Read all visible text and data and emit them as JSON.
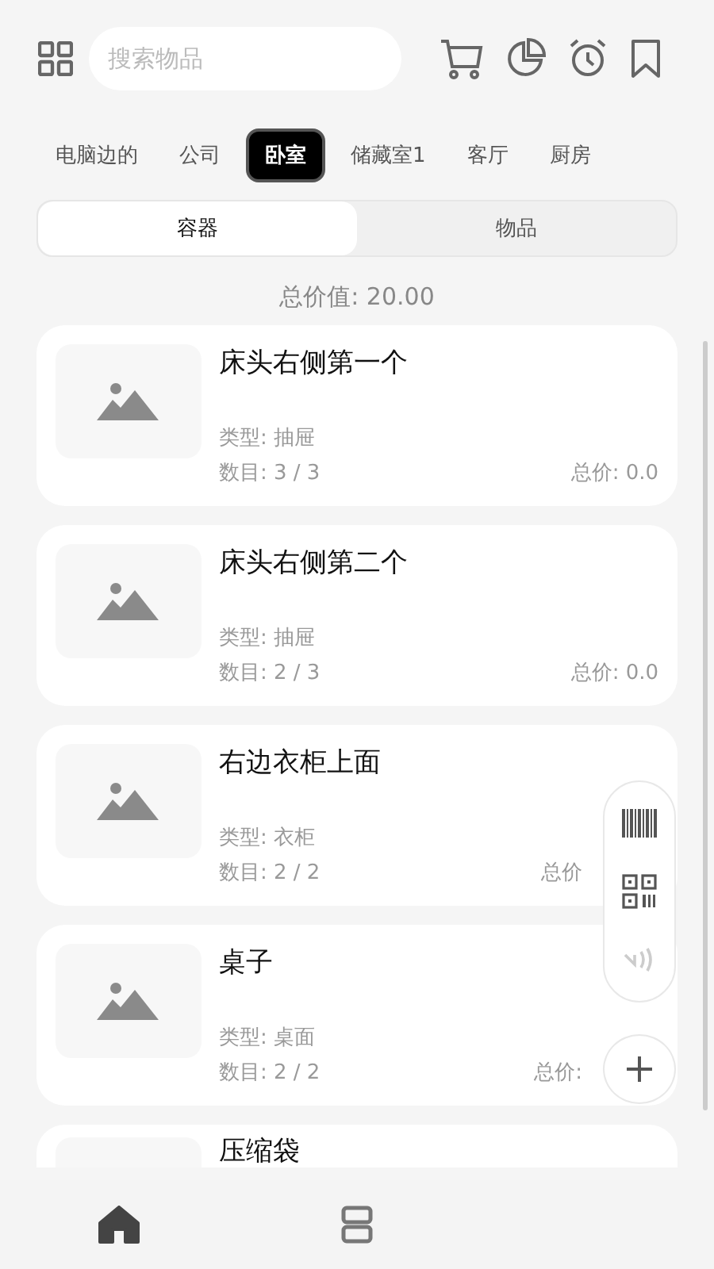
{
  "search": {
    "placeholder": "搜索物品"
  },
  "rooms": [
    {
      "label": "电脑边的",
      "selected": false
    },
    {
      "label": "公司",
      "selected": false
    },
    {
      "label": "卧室",
      "selected": true
    },
    {
      "label": "储藏室1",
      "selected": false
    },
    {
      "label": "客厅",
      "selected": false
    },
    {
      "label": "厨房",
      "selected": false
    }
  ],
  "segments": [
    {
      "label": "容器",
      "selected": true
    },
    {
      "label": "物品",
      "selected": false
    }
  ],
  "total_value": "总价值:  20.00",
  "containers": [
    {
      "name": "床头右侧第一个",
      "type": "类型: 抽屉",
      "count": "数目: 3 / 3",
      "price": "总价: 0.0"
    },
    {
      "name": "床头右侧第二个",
      "type": "类型: 抽屉",
      "count": "数目: 2 / 3",
      "price": "总价: 0.0"
    },
    {
      "name": "右边衣柜上面",
      "type": "类型: 衣柜",
      "count": "数目: 2 / 2",
      "price": "总价"
    },
    {
      "name": "桌子",
      "type": "类型: 桌面",
      "count": "数目: 2 / 2",
      "price": "总价:"
    },
    {
      "name": "压缩袋"
    }
  ],
  "bottom_nav": [
    {
      "kind": "home",
      "selected": true
    },
    {
      "kind": "list",
      "selected": false
    }
  ]
}
